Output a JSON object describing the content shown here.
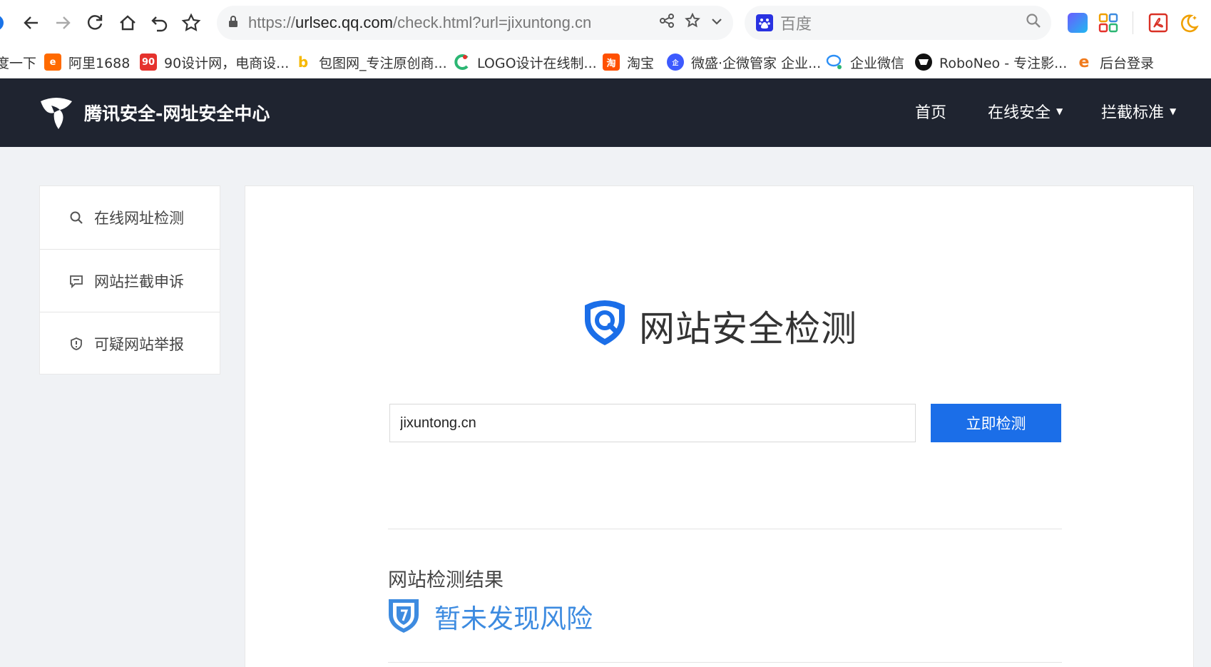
{
  "browser": {
    "address": {
      "scheme": "https://",
      "host": "urlsec.qq.com",
      "path": "/check.html?url=jixuntong.cn"
    },
    "search": {
      "engine": "百度"
    }
  },
  "bookmarks": [
    {
      "label": "度一下",
      "icon": "partial-icon",
      "color": "#1a73e8"
    },
    {
      "label": "阿里1688",
      "icon": "1688-icon",
      "color": "#ff6a00"
    },
    {
      "label": "90设计网，电商设...",
      "icon": "90-icon",
      "color": "#e5322d",
      "icon_text": "90"
    },
    {
      "label": "包图网_专注原创商...",
      "icon": "baotu-icon",
      "color": "#f6b800",
      "icon_text": "b"
    },
    {
      "label": "LOGO设计在线制...",
      "icon": "logo-maker-icon",
      "color": "#2bb673"
    },
    {
      "label": "淘宝",
      "icon": "taobao-icon",
      "color": "#ff5000",
      "icon_text": "淘"
    },
    {
      "label": "微盛·企微管家 企业...",
      "icon": "weisheng-icon",
      "color": "#3d5afe"
    },
    {
      "label": "企业微信",
      "icon": "wecom-icon",
      "color": "#2c8ff5"
    },
    {
      "label": "RoboNeo - 专注影...",
      "icon": "roboneo-icon",
      "color": "#111111"
    },
    {
      "label": "后台登录",
      "icon": "e-icon",
      "color": "#f07a1c",
      "icon_text": "e"
    }
  ],
  "site": {
    "title": "腾讯安全-网址安全中心",
    "nav": [
      {
        "label": "首页",
        "dropdown": false
      },
      {
        "label": "在线安全",
        "dropdown": true
      },
      {
        "label": "拦截标准",
        "dropdown": true
      }
    ]
  },
  "sidebar": {
    "items": [
      {
        "label": "在线网址检测",
        "icon": "search-icon"
      },
      {
        "label": "网站拦截申诉",
        "icon": "comment-icon"
      },
      {
        "label": "可疑网站举报",
        "icon": "shield-alert-icon"
      }
    ]
  },
  "main": {
    "hero_title": "网站安全检测",
    "input_value": "jixuntong.cn",
    "check_button": "立即检测",
    "result_title": "网站检测结果",
    "result_status": "暂未发现风险"
  },
  "colors": {
    "header_bg": "#1f2430",
    "primary_button": "#1b6ee8",
    "result_text": "#3d8be0"
  }
}
